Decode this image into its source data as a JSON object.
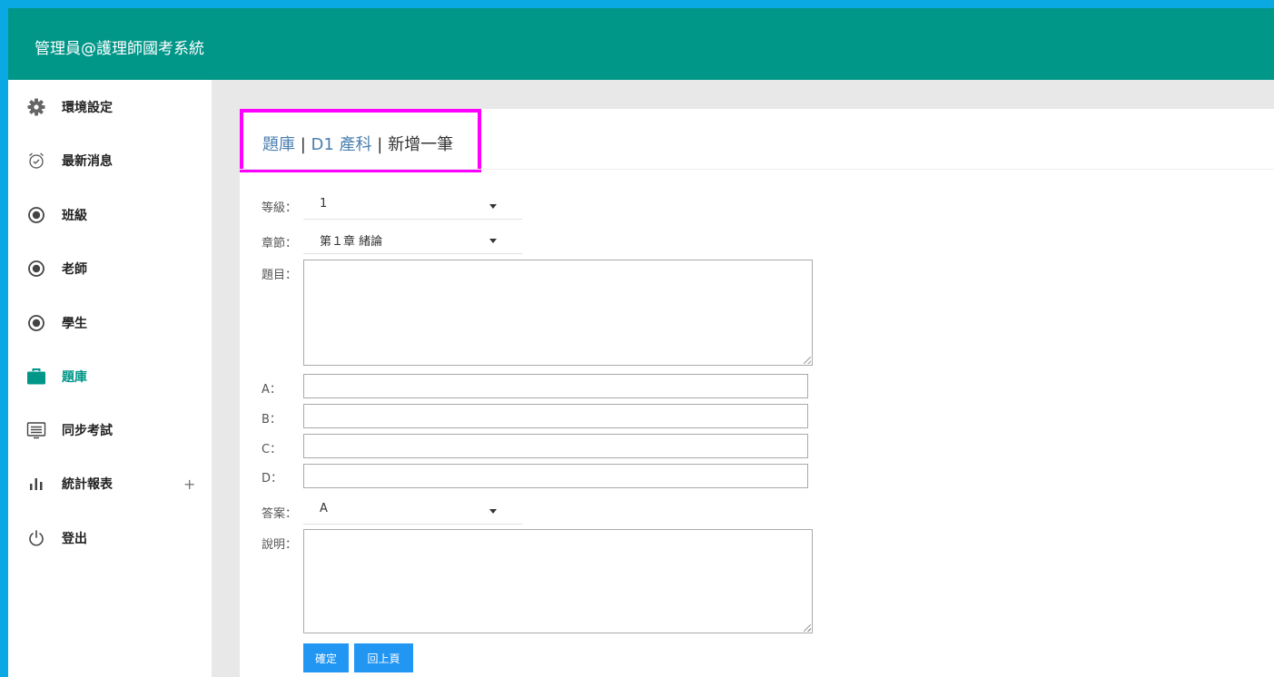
{
  "app": {
    "title": "管理員@護理師國考系統"
  },
  "sidebar": {
    "items": [
      {
        "label": "環境設定",
        "icon": "gear-icon"
      },
      {
        "label": "最新消息",
        "icon": "alarm-clock-icon"
      },
      {
        "label": "班級",
        "icon": "radio-dot-icon"
      },
      {
        "label": "老師",
        "icon": "radio-dot-icon"
      },
      {
        "label": "學生",
        "icon": "radio-dot-icon"
      },
      {
        "label": "題庫",
        "icon": "briefcase-icon",
        "active": true
      },
      {
        "label": "同步考試",
        "icon": "list-window-icon"
      },
      {
        "label": "統計報表",
        "icon": "bar-chart-icon",
        "expand": "+"
      },
      {
        "label": "登出",
        "icon": "power-icon"
      }
    ]
  },
  "breadcrumb": {
    "crumb1": "題庫",
    "sep1": " | ",
    "crumb2": "D1 產科",
    "sep2": " | ",
    "current": "新增一筆"
  },
  "form": {
    "level_label": "等級：",
    "level_value": "1",
    "chapter_label": "章節：",
    "chapter_value": "第１章 緒論",
    "question_label": "題目：",
    "a_label": "A：",
    "b_label": "B：",
    "c_label": "C：",
    "d_label": "D：",
    "answer_label": "答案：",
    "answer_value": "A",
    "explain_label": "說明：",
    "confirm_button": "確定",
    "back_button": "回上頁"
  },
  "colors": {
    "header": "#009688",
    "accent": "#009688",
    "frame": "#0aa9e3",
    "button": "#2196f3",
    "highlight": "#ff00ff"
  }
}
